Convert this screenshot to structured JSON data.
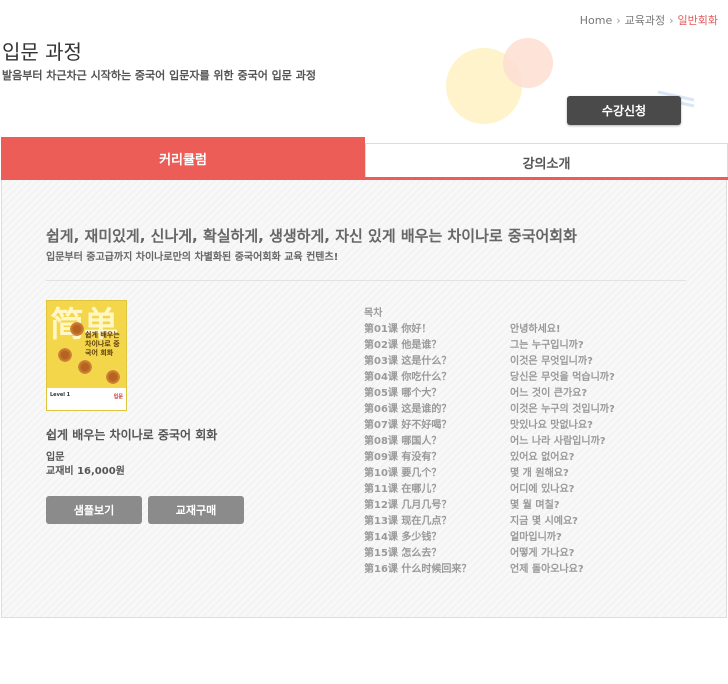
{
  "breadcrumb": {
    "home": "Home",
    "section": "교육과정",
    "current": "일반회화"
  },
  "header": {
    "title": "입문 과정",
    "subtitle": "발음부터 차근차근 시작하는 중국어 입문자를 위한 중국어 입문 과정",
    "enroll_label": "수강신청"
  },
  "tabs": [
    {
      "label": "커리큘럼",
      "active": true
    },
    {
      "label": "강의소개",
      "active": false
    }
  ],
  "colors": {
    "accent": "#ec5d58",
    "dark_button": "#4a4a4a",
    "gray_button": "#8b8b8b",
    "breadcrumb_current": "#e55a5a"
  },
  "content": {
    "headline": "쉽게, 재미있게, 신나게, 확실하게, 생생하게, 자신 있게 배우는 차이나로 중국어회화",
    "tagline": "입문부터 중고급까지 차이나로만의 차별화된 중국어회화 교육 컨텐츠!",
    "book": {
      "cover_chars": "简单",
      "cover_title": "쉽게 배우는 차이나로 중국어 회화",
      "cover_level": "Level 1",
      "cover_badge": "입문",
      "title": "쉽게 배우는 차이나로 중국어 회화",
      "level": "입문",
      "price": "교재비 16,000원",
      "sample_label": "샘플보기",
      "buy_label": "교재구매"
    },
    "toc": {
      "header": "목차",
      "lessons": [
        {
          "zh": "第01课 你好！",
          "ko": "안녕하세요!"
        },
        {
          "zh": "第02课 他是谁？",
          "ko": "그는 누구입니까?"
        },
        {
          "zh": "第03课 这是什么？",
          "ko": "이것은 무엇입니까?"
        },
        {
          "zh": "第04课 你吃什么？",
          "ko": "당신은 무엇을 먹습니까?"
        },
        {
          "zh": "第05课 哪个大？",
          "ko": "어느 것이 큰가요?"
        },
        {
          "zh": "第06课 这是谁的？",
          "ko": "이것은 누구의 것입니까?"
        },
        {
          "zh": "第07课 好不好喝？",
          "ko": "맛있나요 맛없나요?"
        },
        {
          "zh": "第08课 哪国人？",
          "ko": "어느 나라 사람입니까?"
        },
        {
          "zh": "第09课 有没有？",
          "ko": "있어요 없어요?"
        },
        {
          "zh": "第10课 要几个？",
          "ko": "몇 개 원해요?"
        },
        {
          "zh": "第11课 在哪儿？",
          "ko": "어디에 있나요?"
        },
        {
          "zh": "第12课 几月几号？",
          "ko": "몇 월 며칠?"
        },
        {
          "zh": "第13课 现在几点？",
          "ko": "지금 몇 시예요?"
        },
        {
          "zh": "第14课 多少钱？",
          "ko": "얼마입니까?"
        },
        {
          "zh": "第15课 怎么去？",
          "ko": "어떻게 가나요?"
        },
        {
          "zh": "第16课 什么时候回来？",
          "ko": "언제 돌아오나요?"
        }
      ]
    }
  }
}
